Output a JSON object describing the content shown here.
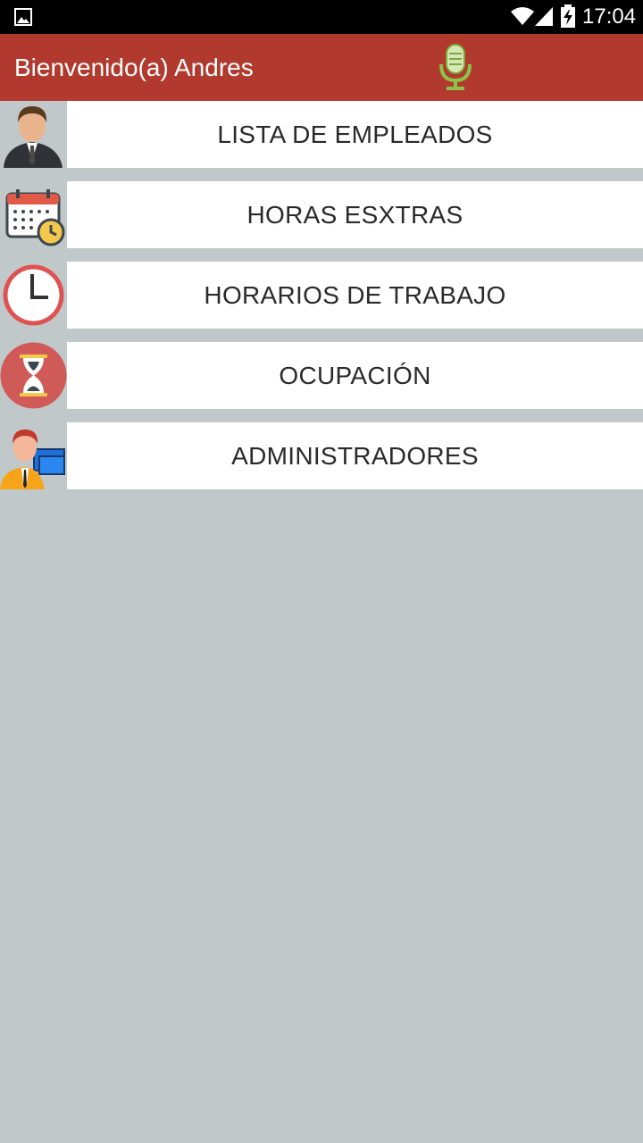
{
  "status_bar": {
    "time": "17:04",
    "icons": [
      "gallery-icon",
      "wifi-icon",
      "signal-icon",
      "battery-charging-icon"
    ]
  },
  "action_bar": {
    "title": "Bienvenido(a) Andres",
    "mic_icon": "microphone-icon"
  },
  "menu": {
    "items": [
      {
        "label": "LISTA DE EMPLEADOS",
        "icon": "businessman-icon"
      },
      {
        "label": "HORAS ESXTRAS",
        "icon": "calendar-clock-icon"
      },
      {
        "label": "HORARIOS DE TRABAJO",
        "icon": "clock-icon"
      },
      {
        "label": "OCUPACIÓN",
        "icon": "hourglass-icon"
      },
      {
        "label": "ADMINISTRADORES",
        "icon": "admin-computer-icon"
      }
    ]
  },
  "colors": {
    "action_bar": "#b1392d",
    "background": "#c1c8c9",
    "button": "#ffffff",
    "mic_accent": "#8bc34a"
  }
}
